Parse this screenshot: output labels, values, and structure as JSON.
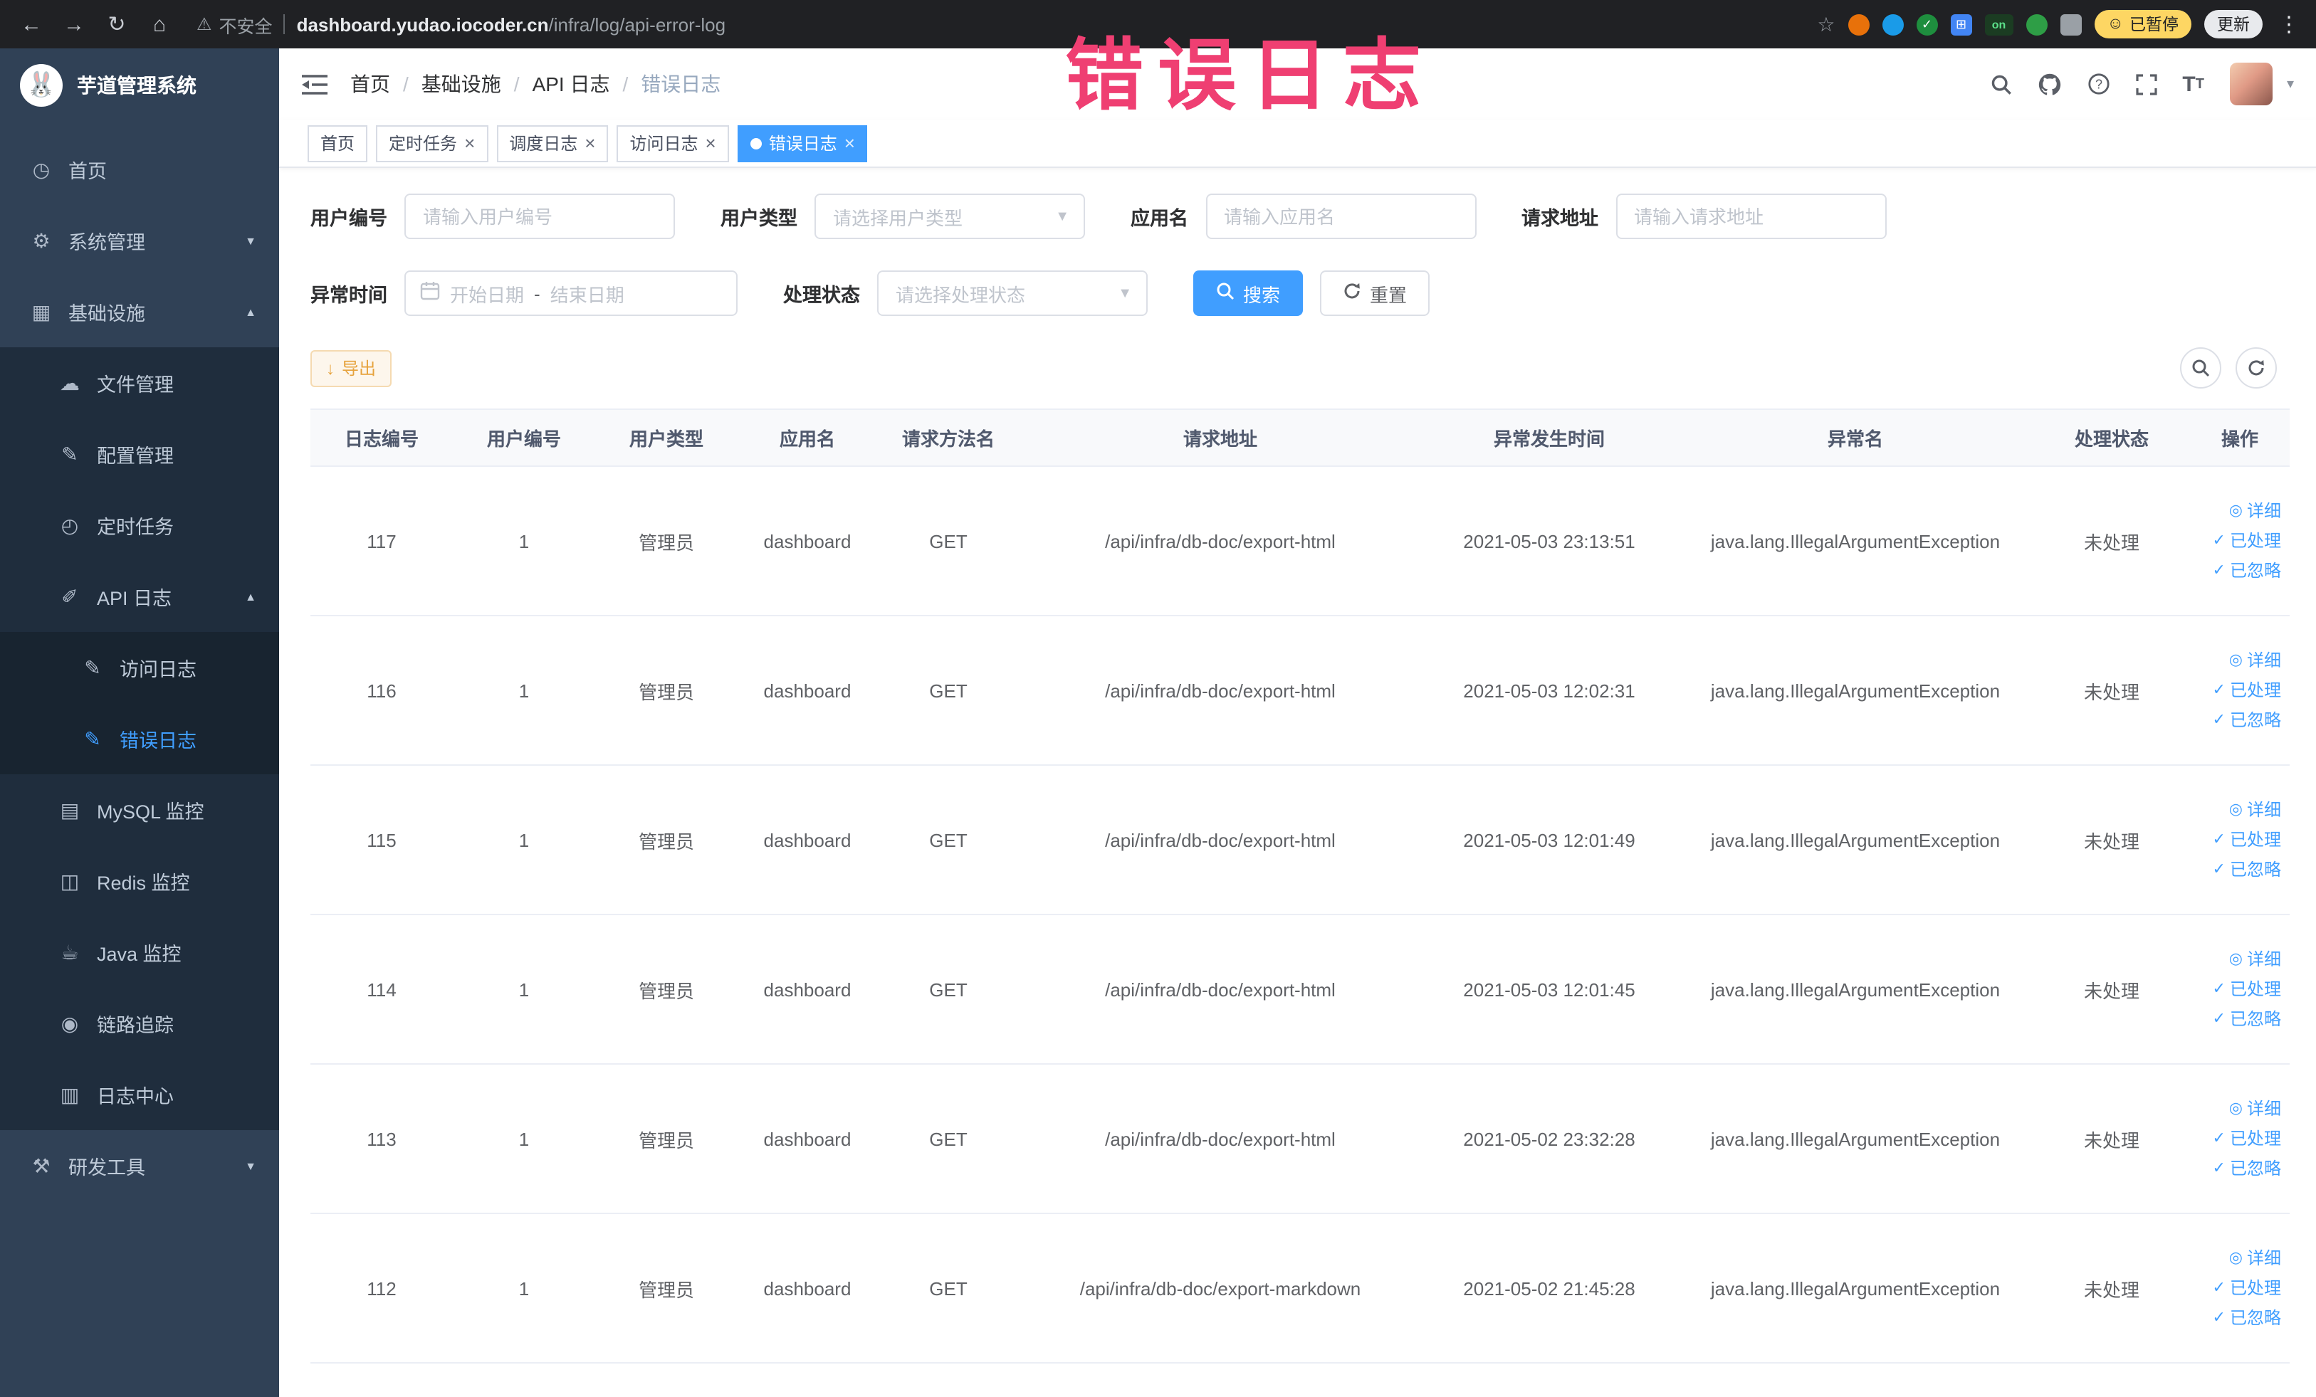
{
  "browser": {
    "security_label": "不安全",
    "url_domain": "dashboard.yudao.iocoder.cn",
    "url_path": "/infra/log/api-error-log",
    "extension_on": "on",
    "paused_label": "已暂停",
    "update_label": "更新"
  },
  "overlay": {
    "text": "错误日志",
    "color": "#ef3f72"
  },
  "sidebar": {
    "logo_title": "芋道管理系统",
    "items": [
      {
        "key": "home",
        "label": "首页",
        "icon": "dashboard-icon",
        "level": 1
      },
      {
        "key": "system-management",
        "label": "系统管理",
        "icon": "gear-icon",
        "level": 1,
        "arrow": "down"
      },
      {
        "key": "infrastructure",
        "label": "基础设施",
        "icon": "infrastructure-icon",
        "level": 1,
        "arrow": "up"
      },
      {
        "key": "file-management",
        "label": "文件管理",
        "icon": "cloud-icon",
        "level": 2
      },
      {
        "key": "config-management",
        "label": "配置管理",
        "icon": "edit-icon",
        "level": 2
      },
      {
        "key": "scheduled-tasks",
        "label": "定时任务",
        "icon": "timer-icon",
        "level": 2
      },
      {
        "key": "api-log",
        "label": "API 日志",
        "icon": "api-log-icon",
        "level": 2,
        "arrow": "up"
      },
      {
        "key": "access-log",
        "label": "访问日志",
        "icon": "access-log-icon",
        "level": 3
      },
      {
        "key": "error-log",
        "label": "错误日志",
        "icon": "error-log-icon",
        "level": 3,
        "active": true
      },
      {
        "key": "mysql-monitor",
        "label": "MySQL 监控",
        "icon": "mysql-icon",
        "level": 2
      },
      {
        "key": "redis-monitor",
        "label": "Redis 监控",
        "icon": "redis-icon",
        "level": 2
      },
      {
        "key": "java-monitor",
        "label": "Java 监控",
        "icon": "java-icon",
        "level": 2
      },
      {
        "key": "trace",
        "label": "链路追踪",
        "icon": "trace-icon",
        "level": 2
      },
      {
        "key": "log-center",
        "label": "日志中心",
        "icon": "log-center-icon",
        "level": 2
      },
      {
        "key": "dev-tools",
        "label": "研发工具",
        "icon": "tools-icon",
        "level": 1,
        "arrow": "down"
      }
    ]
  },
  "breadcrumb": {
    "items": [
      "首页",
      "基础设施",
      "API 日志",
      "错误日志"
    ]
  },
  "tabs": [
    {
      "key": "home",
      "label": "首页",
      "closable": false,
      "active": false
    },
    {
      "key": "scheduled-tasks",
      "label": "定时任务",
      "closable": true,
      "active": false
    },
    {
      "key": "schedule-log",
      "label": "调度日志",
      "closable": true,
      "active": false
    },
    {
      "key": "access-log",
      "label": "访问日志",
      "closable": true,
      "active": false
    },
    {
      "key": "error-log",
      "label": "错误日志",
      "closable": true,
      "active": true
    }
  ],
  "filters": {
    "user_id": {
      "label": "用户编号",
      "placeholder": "请输入用户编号"
    },
    "user_type": {
      "label": "用户类型",
      "placeholder": "请选择用户类型"
    },
    "app_name": {
      "label": "应用名",
      "placeholder": "请输入应用名"
    },
    "request_url": {
      "label": "请求地址",
      "placeholder": "请输入请求地址"
    },
    "exception_time": {
      "label": "异常时间",
      "start_placeholder": "开始日期",
      "separator": "-",
      "end_placeholder": "结束日期"
    },
    "process_status": {
      "label": "处理状态",
      "placeholder": "请选择处理状态"
    },
    "search_button": "搜索",
    "reset_button": "重置"
  },
  "toolbar": {
    "export_button": "导出"
  },
  "table": {
    "columns": [
      "日志编号",
      "用户编号",
      "用户类型",
      "应用名",
      "请求方法名",
      "请求地址",
      "异常发生时间",
      "异常名",
      "处理状态",
      "操作"
    ],
    "row_actions": [
      {
        "key": "detail",
        "label": "详细",
        "icon": "view-icon"
      },
      {
        "key": "processed",
        "label": "已处理",
        "icon": "check-icon"
      },
      {
        "key": "ignored",
        "label": "已忽略",
        "icon": "check-icon"
      }
    ],
    "rows": [
      {
        "id": "117",
        "user_id": "1",
        "user_type": "管理员",
        "app": "dashboard",
        "method": "GET",
        "url": "/api/infra/db-doc/export-html",
        "time": "2021-05-03 23:13:51",
        "exception": "java.lang.IllegalArgumentException",
        "status": "未处理"
      },
      {
        "id": "116",
        "user_id": "1",
        "user_type": "管理员",
        "app": "dashboard",
        "method": "GET",
        "url": "/api/infra/db-doc/export-html",
        "time": "2021-05-03 12:02:31",
        "exception": "java.lang.IllegalArgumentException",
        "status": "未处理"
      },
      {
        "id": "115",
        "user_id": "1",
        "user_type": "管理员",
        "app": "dashboard",
        "method": "GET",
        "url": "/api/infra/db-doc/export-html",
        "time": "2021-05-03 12:01:49",
        "exception": "java.lang.IllegalArgumentException",
        "status": "未处理"
      },
      {
        "id": "114",
        "user_id": "1",
        "user_type": "管理员",
        "app": "dashboard",
        "method": "GET",
        "url": "/api/infra/db-doc/export-html",
        "time": "2021-05-03 12:01:45",
        "exception": "java.lang.IllegalArgumentException",
        "status": "未处理"
      },
      {
        "id": "113",
        "user_id": "1",
        "user_type": "管理员",
        "app": "dashboard",
        "method": "GET",
        "url": "/api/infra/db-doc/export-html",
        "time": "2021-05-02 23:32:28",
        "exception": "java.lang.IllegalArgumentException",
        "status": "未处理"
      },
      {
        "id": "112",
        "user_id": "1",
        "user_type": "管理员",
        "app": "dashboard",
        "method": "GET",
        "url": "/api/infra/db-doc/export-markdown",
        "time": "2021-05-02 21:45:28",
        "exception": "java.lang.IllegalArgumentException",
        "status": "未处理"
      }
    ]
  }
}
